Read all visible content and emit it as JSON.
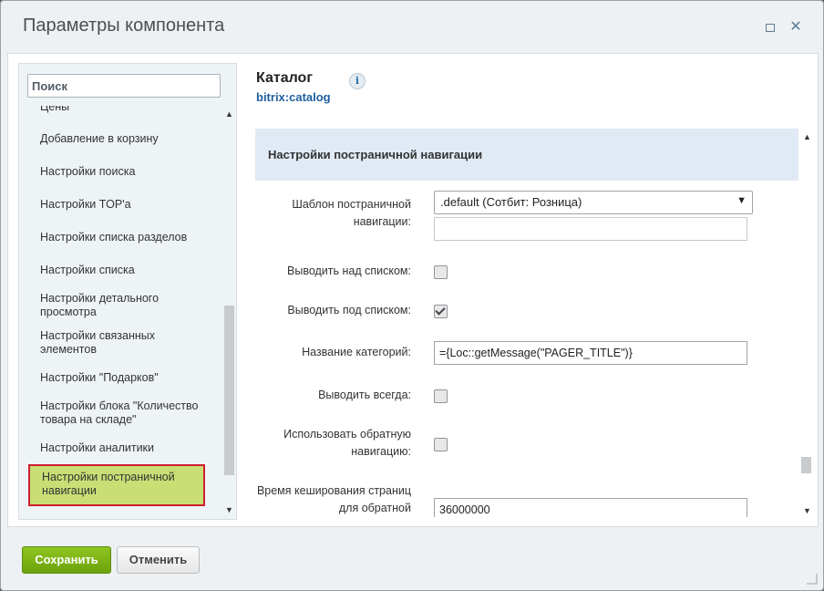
{
  "dialog": {
    "title": "Параметры компонента"
  },
  "sidebar": {
    "search_placeholder": "Поиск",
    "items": [
      {
        "label": "Цены"
      },
      {
        "label": "Добавление в корзину"
      },
      {
        "label": "Настройки поиска"
      },
      {
        "label": "Настройки TOP'а"
      },
      {
        "label": "Настройки списка разделов"
      },
      {
        "label": "Настройки списка"
      },
      {
        "label": "Настройки детального просмотра"
      },
      {
        "label": "Настройки связанных элементов"
      },
      {
        "label": "Настройки \"Подарков\""
      },
      {
        "label": "Настройки блока \"Количество товара на складе\""
      },
      {
        "label": "Настройки аналитики"
      },
      {
        "label": "Настройки постраничной навигации"
      }
    ],
    "active_index": 11
  },
  "component": {
    "name": "Каталог",
    "code": "bitrix:catalog",
    "info_icon": "i"
  },
  "section": {
    "title": "Настройки постраничной навигации"
  },
  "fields": {
    "pager_template_label": "Шаблон постраничной навигации:",
    "pager_template_value": ".default (Сотбит: Розница)",
    "pager_template_extra": "",
    "show_top_label": "Выводить над списком:",
    "show_top_checked": false,
    "show_bottom_label": "Выводить под списком:",
    "show_bottom_checked": true,
    "category_name_label": "Название категорий:",
    "category_name_value": "={Loc::getMessage(\"PAGER_TITLE\")}",
    "show_always_label": "Выводить всегда:",
    "show_always_checked": false,
    "desc_nav_label": "Использовать обратную навигацию:",
    "desc_nav_checked": false,
    "cache_time_label": "Время кеширования страниц для обратной",
    "cache_time_value": "36000000"
  },
  "footer": {
    "save_label": "Сохранить",
    "cancel_label": "Отменить"
  },
  "colors": {
    "active_item_bg": "#c9de74",
    "active_item_border": "#cc1f2f",
    "section_bg": "#e0eaf4",
    "save_button": "#7ab317",
    "link_blue": "#1f5f9e"
  }
}
